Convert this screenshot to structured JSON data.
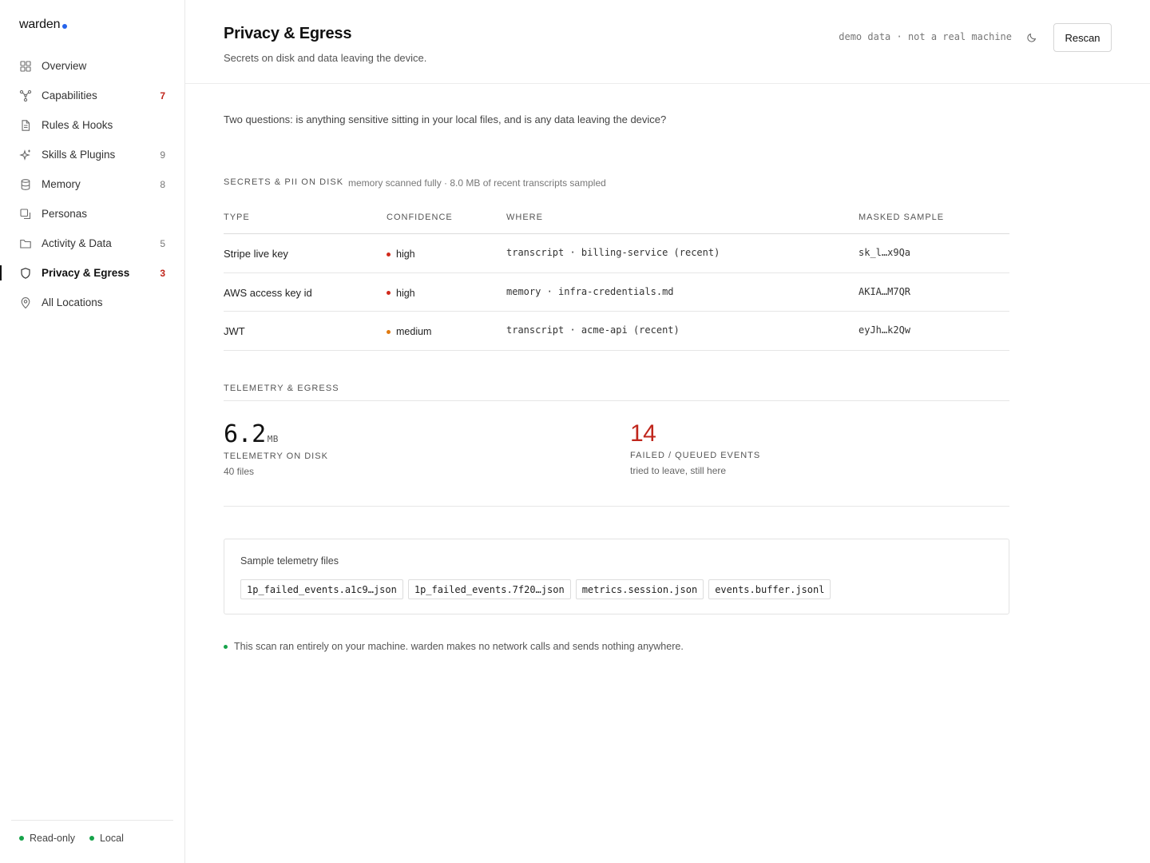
{
  "app": {
    "name": "warden"
  },
  "sidebar": {
    "items": [
      {
        "label": "Overview",
        "icon": "grid-icon",
        "count": ""
      },
      {
        "label": "Capabilities",
        "icon": "network-icon",
        "count": "7",
        "count_color": "red"
      },
      {
        "label": "Rules & Hooks",
        "icon": "document-icon",
        "count": ""
      },
      {
        "label": "Skills & Plugins",
        "icon": "sparkle-icon",
        "count": "9"
      },
      {
        "label": "Memory",
        "icon": "database-icon",
        "count": "8"
      },
      {
        "label": "Personas",
        "icon": "copy-icon",
        "count": ""
      },
      {
        "label": "Activity & Data",
        "icon": "folder-icon",
        "count": "5"
      },
      {
        "label": "Privacy & Egress",
        "icon": "shield-icon",
        "count": "3",
        "count_color": "red",
        "active": true
      },
      {
        "label": "All Locations",
        "icon": "pin-icon",
        "count": ""
      }
    ],
    "footer": {
      "readonly": "Read-only",
      "local": "Local"
    }
  },
  "header": {
    "title": "Privacy & Egress",
    "subtitle": "Secrets on disk and data leaving the device.",
    "demo_note": "demo data · not a real machine",
    "rescan_label": "Rescan"
  },
  "main": {
    "intro": "Two questions: is anything sensitive sitting in your local files, and is any data leaving the device?",
    "secrets": {
      "title": "Secrets & PII on disk",
      "note": "memory scanned fully · 8.0 MB of recent transcripts sampled",
      "columns": [
        "Type",
        "Confidence",
        "Where",
        "Masked sample"
      ],
      "rows": [
        {
          "type": "Stripe live key",
          "confidence": "high",
          "where": "transcript · billing-service (recent)",
          "masked": "sk_l…x9Qa"
        },
        {
          "type": "AWS access key id",
          "confidence": "high",
          "where": "memory · infra-credentials.md",
          "masked": "AKIA…M7QR"
        },
        {
          "type": "JWT",
          "confidence": "medium",
          "where": "transcript · acme-api (recent)",
          "masked": "eyJh…k2Qw"
        }
      ]
    },
    "telemetry": {
      "title": "Telemetry & Egress",
      "on_disk": {
        "value": "6.2",
        "unit": "MB",
        "caption": "Telemetry on disk",
        "sub": "40 files"
      },
      "failed": {
        "value": "14",
        "caption": "Failed / queued events",
        "sub": "tried to leave, still here"
      }
    },
    "samples": {
      "title": "Sample telemetry files",
      "files": [
        "1p_failed_events.a1c9…json",
        "1p_failed_events.7f20…json",
        "metrics.session.json",
        "events.buffer.jsonl"
      ]
    },
    "footer_note": "This scan ran entirely on your machine. warden makes no network calls and sends nothing anywhere."
  },
  "colors": {
    "accent": "#2563eb",
    "danger": "#c0261c",
    "high": "#d12a1c",
    "medium": "#e07a10",
    "ok": "#16a34a"
  }
}
